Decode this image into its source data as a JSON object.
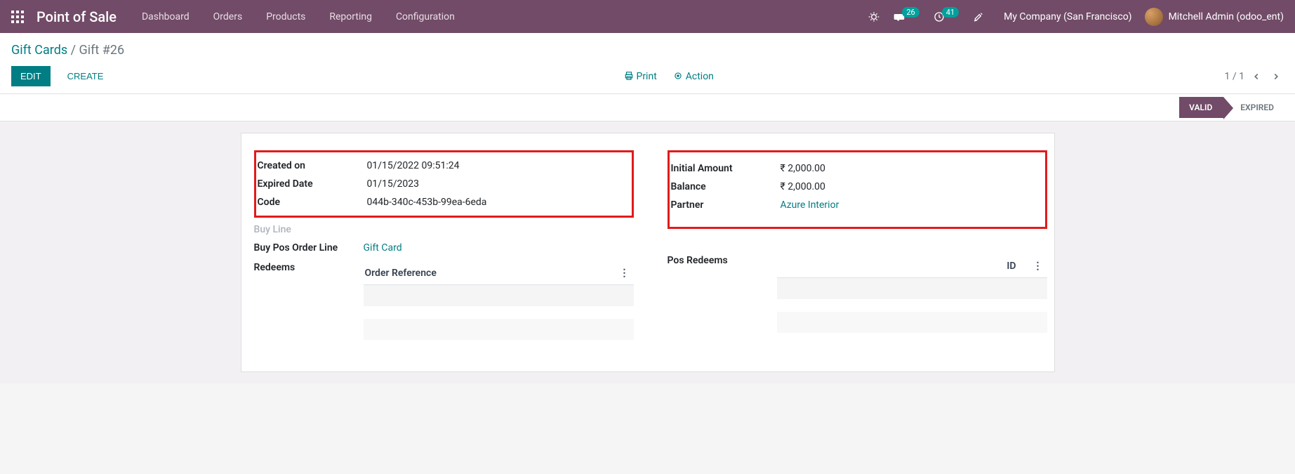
{
  "topbar": {
    "brand": "Point of Sale",
    "nav": [
      "Dashboard",
      "Orders",
      "Products",
      "Reporting",
      "Configuration"
    ],
    "messages_badge": "26",
    "activities_badge": "41",
    "company": "My Company (San Francisco)",
    "user": "Mitchell Admin (odoo_ent)"
  },
  "breadcrumb": {
    "parent": "Gift Cards",
    "current": "Gift #26"
  },
  "buttons": {
    "edit": "Edit",
    "create": "Create",
    "print": "Print",
    "action": "Action"
  },
  "pager": {
    "text": "1 / 1"
  },
  "status": {
    "valid": "VALID",
    "expired": "EXPIRED"
  },
  "form": {
    "left": {
      "created_on_label": "Created on",
      "created_on_value": "01/15/2022 09:51:24",
      "expired_label": "Expired Date",
      "expired_value": "01/15/2023",
      "code_label": "Code",
      "code_value": "044b-340c-453b-99ea-6eda",
      "buy_line_label": "Buy Line",
      "buy_pos_label": "Buy Pos Order Line",
      "buy_pos_value": "Gift Card",
      "redeems_label": "Redeems"
    },
    "right": {
      "initial_label": "Initial Amount",
      "initial_value": "₹ 2,000.00",
      "balance_label": "Balance",
      "balance_value": "₹ 2,000.00",
      "partner_label": "Partner",
      "partner_value": "Azure Interior",
      "pos_redeems_label": "Pos Redeems"
    }
  },
  "tables": {
    "order_ref_header": "Order Reference",
    "id_header": "ID"
  }
}
